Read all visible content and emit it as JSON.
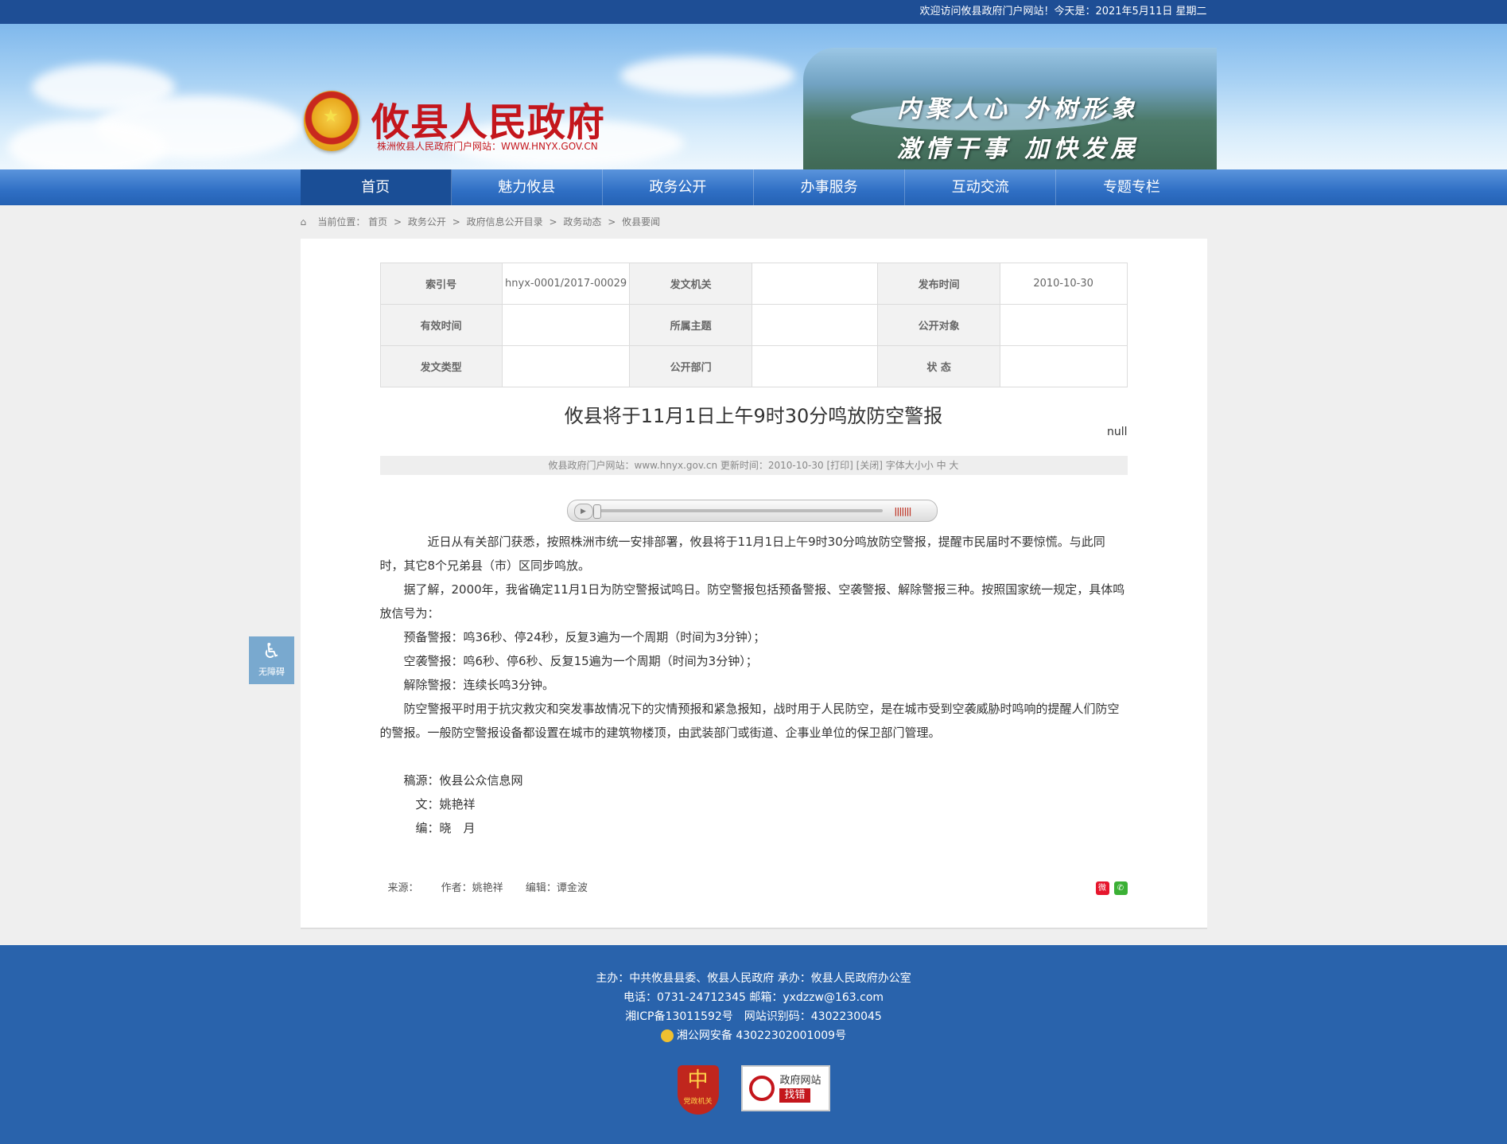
{
  "topbar": {
    "welcome": "欢迎访问攸县政府门户网站！今天是：2021年5月11日 星期二"
  },
  "header": {
    "title": "攸县人民政府",
    "subtitle": "株洲攸县人民政府门户网站：WWW.HNYX.GOV.CN",
    "slogan_line1": "内聚人心 外树形象",
    "slogan_line2": "激情干事 加快发展"
  },
  "nav": {
    "items": [
      "首页",
      "魅力攸县",
      "政务公开",
      "办事服务",
      "互动交流",
      "专题专栏"
    ]
  },
  "breadcrumb": {
    "label": "当前位置：",
    "items": [
      "首页",
      "政务公开",
      "政府信息公开目录",
      "政务动态",
      "攸县要闻"
    ],
    "sep": ">"
  },
  "meta": {
    "index_no_label": "索引号",
    "index_no": "hnyx-0001/2017-00029",
    "issuer_label": "发文机关",
    "issuer": "",
    "pub_date_label": "发布时间",
    "pub_date": "2010-10-30",
    "valid_label": "有效时间",
    "valid": "",
    "topic_label": "所属主题",
    "topic": "",
    "audience_label": "公开对象",
    "audience": "",
    "doc_type_label": "发文类型",
    "doc_type": "",
    "dept_label": "公开部门",
    "dept": "",
    "status_label": "状 态",
    "status": ""
  },
  "article": {
    "title": "攸县将于11月1日上午9时30分鸣放防空警报",
    "null_mark": "null",
    "info_bar": "攸县政府门户网站：www.hnyx.gov.cn   更新时间：2010-10-30  [打印]  [关闭]   字体大小小 中 大",
    "paragraphs": [
      "近日从有关部门获悉，按照株洲市统一安排部署，攸县将于11月1日上午9时30分鸣放防空警报，提醒市民届时不要惊慌。与此同时，其它8个兄弟县（市）区同步鸣放。",
      "据了解，2000年，我省确定11月1日为防空警报试鸣日。防空警报包括预备警报、空袭警报、解除警报三种。按照国家统一规定，具体鸣放信号为：",
      "预备警报：鸣36秒、停24秒，反复3遍为一个周期（时间为3分钟）；",
      "空袭警报：鸣6秒、停6秒、反复15遍为一个周期（时间为3分钟）；",
      "解除警报：连续长鸣3分钟。",
      "防空警报平时用于抗灾救灾和突发事故情况下的灾情预报和紧急报知，战时用于人民防空，是在城市受到空袭威胁时鸣响的提醒人们防空的警报。一般防空警报设备都设置在城市的建筑物楼顶，由武装部门或街道、企事业单位的保卫部门管理。"
    ],
    "credits": [
      "稿源：攸县公众信息网",
      "文：姚艳祥",
      "编：晓　月"
    ]
  },
  "foot_meta": {
    "source": "来源：",
    "author": "作者：姚艳祥",
    "editor": "编辑：谭金波"
  },
  "accessibility": {
    "label": "无障碍"
  },
  "footer": {
    "line1": "主办：中共攸县县委、攸县人民政府 承办：攸县人民政府办公室",
    "line2": "电话：0731-24712345 邮箱：yxdzzw@163.com",
    "line3": "湘ICP备13011592号　网站识别码：4302230045",
    "line4": "湘公网安备 43022302001009号",
    "badge1": "党政机关",
    "badge2_top": "政府网站",
    "badge2_bottom": "找错"
  }
}
